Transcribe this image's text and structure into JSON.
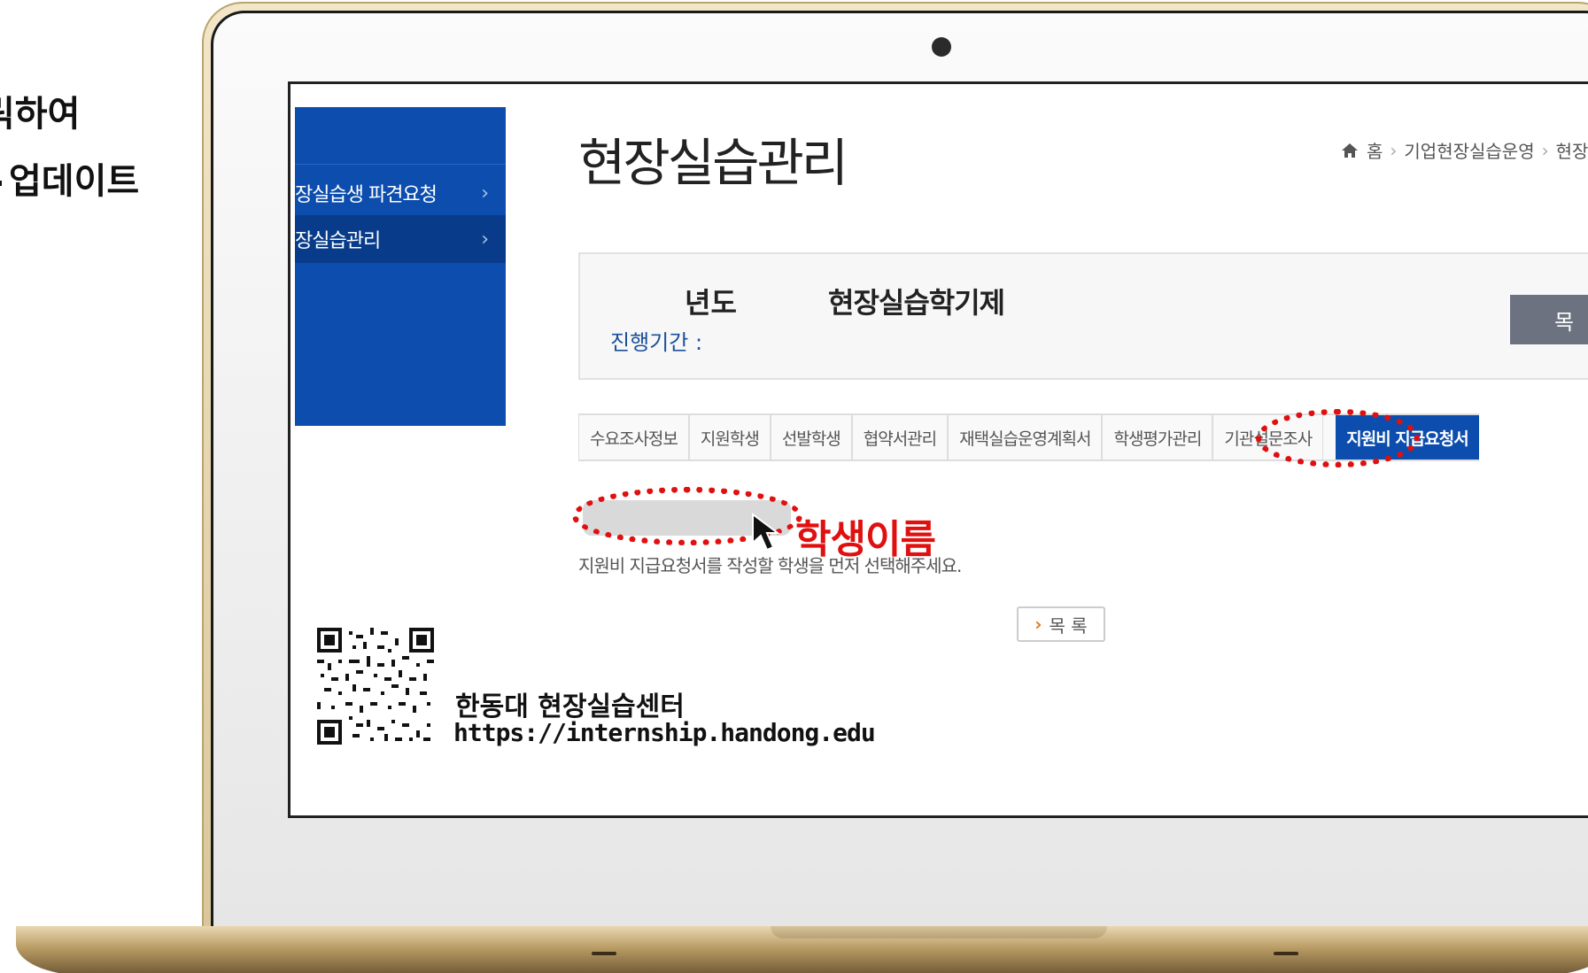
{
  "slide": {
    "title_fragment": "",
    "line1": "릭하여",
    "line2": "업데이트"
  },
  "sidebar": {
    "items": [
      {
        "label": "장실습생 파견요청",
        "arrow": "›"
      },
      {
        "label": "장실습관리",
        "arrow": "›"
      }
    ]
  },
  "header": {
    "title": "현장실습관리",
    "breadcrumb": [
      "홈",
      "기업현장실습운영",
      "현장"
    ]
  },
  "info": {
    "year_label": "년도",
    "semester_label": "현장실습학기제",
    "period_label": "진행기간 :",
    "list_button": "목"
  },
  "tabs": [
    {
      "label": "수요조사정보"
    },
    {
      "label": "지원학생"
    },
    {
      "label": "선발학생"
    },
    {
      "label": "협약서관리"
    },
    {
      "label": "재택실습운영계획서"
    },
    {
      "label": "학생평가관리"
    },
    {
      "label": "기관설문조사"
    },
    {
      "label": "지원비 지급요청서",
      "active": true
    }
  ],
  "annotation": {
    "student_label": "학생이름",
    "highlight_color": "#e01010"
  },
  "notice": "지원비 지급요청서를 작성할 학생을 먼저 선택해주세요.",
  "list_button": {
    "chevron": "›",
    "label": "목 록"
  },
  "footer": {
    "center_name": "한동대 현장실습센터",
    "url": "https://internship.handong.edu"
  },
  "colors": {
    "brand_blue": "#0c4dad",
    "annotation_red": "#e01010"
  }
}
